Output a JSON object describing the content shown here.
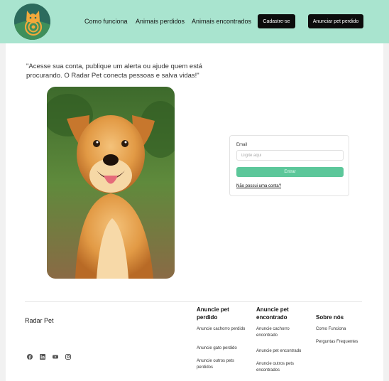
{
  "colors": {
    "header_bg": "#a9e4cf",
    "accent": "#5cc79a",
    "dark_button": "#0c0c0c"
  },
  "header": {
    "logo_icon": "radar-pet-logo",
    "nav": [
      "Como funciona",
      "Animais perdidos",
      "Animais encontrados"
    ],
    "signup_label": "Cadastre-se",
    "announce_label": "Anunciar pet perdido"
  },
  "hero": {
    "quote": "\"Acesse sua conta, publique um alerta ou ajude quem está procurando. O Radar Pet conecta pessoas e salva vidas!\"",
    "image_icon": "dog-photo"
  },
  "login": {
    "email_label": "Email",
    "email_placeholder": "Digite aqui",
    "email_value": "",
    "submit_label": "Entrar",
    "signup_link": "Não possui uma conta?"
  },
  "footer": {
    "brand": "Radar Pet",
    "social_icons": [
      "facebook-icon",
      "linkedin-icon",
      "youtube-icon",
      "instagram-icon"
    ],
    "columns": [
      {
        "title": "Anuncie pet perdido",
        "links": [
          "Anuncie cachorro perdido",
          "Anuncie gato perdido",
          "Anuncie outros pets perdidos"
        ]
      },
      {
        "title": "Anuncie pet encontrado",
        "links": [
          "Anuncie cachorro encontrado",
          "Anuncie pet encontrado",
          "Anuncie outros pets encontrados"
        ]
      },
      {
        "title": "Sobre nós",
        "links": [
          "Como Funciona",
          "Perguntas Frequentes"
        ]
      }
    ]
  }
}
